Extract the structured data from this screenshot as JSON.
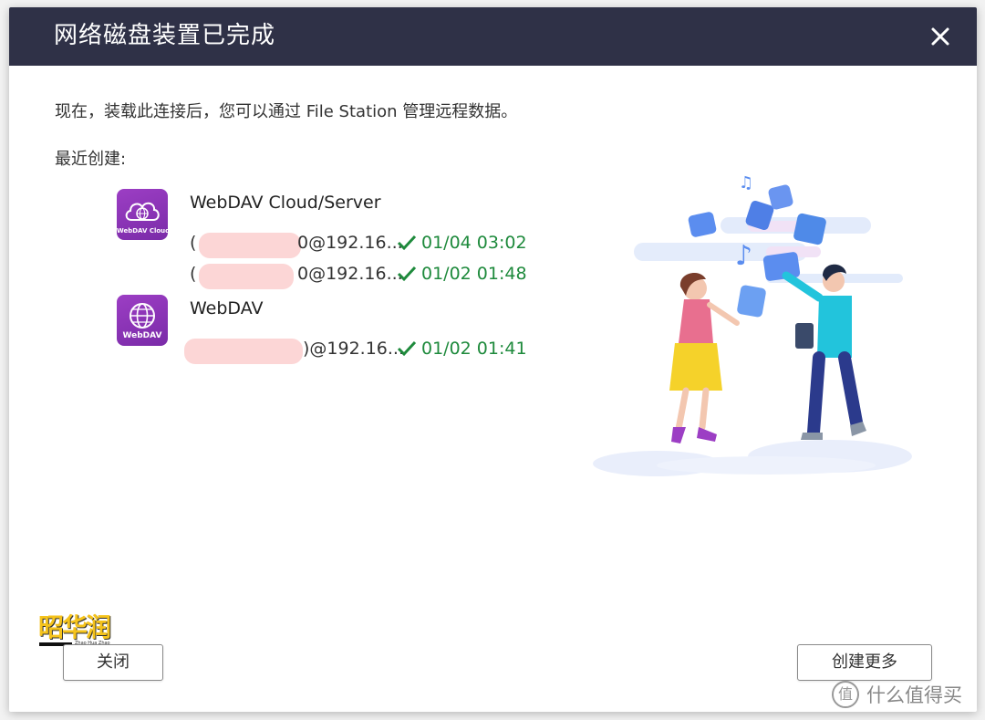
{
  "dialog": {
    "title": "网络磁盘装置已完成",
    "close_icon": "close-icon"
  },
  "body": {
    "description": "现在，装载此连接后，您可以通过 File Station 管理远程数据。",
    "recent_label": "最近创建:"
  },
  "entries": [
    {
      "name": "WebDAV Cloud/Server",
      "icon_caption": "WebDAV Cloud",
      "icon": "webdav-cloud-icon",
      "connections": [
        {
          "paren": "(",
          "address": "0@192.16...",
          "status": "01/04 03:02"
        },
        {
          "paren": "(",
          "address": "0@192.16...",
          "status": "01/02 01:48"
        }
      ]
    },
    {
      "name": "WebDAV",
      "icon_caption": "WebDAV",
      "icon": "webdav-globe-icon",
      "connections": [
        {
          "paren": "(",
          "address": ")@192.16...",
          "status": "01/02 01:41"
        }
      ]
    }
  ],
  "buttons": {
    "close": "关闭",
    "create_more": "创建更多"
  },
  "watermark": {
    "logo_text": "昭华润",
    "logo_sub": "Zhao Hua Zhao",
    "site_badge": "值",
    "site_text": "什么值得买"
  },
  "colors": {
    "titlebar": "#2f3147",
    "status_green": "#1e8a3c",
    "icon_purple": "#8a33b8"
  }
}
